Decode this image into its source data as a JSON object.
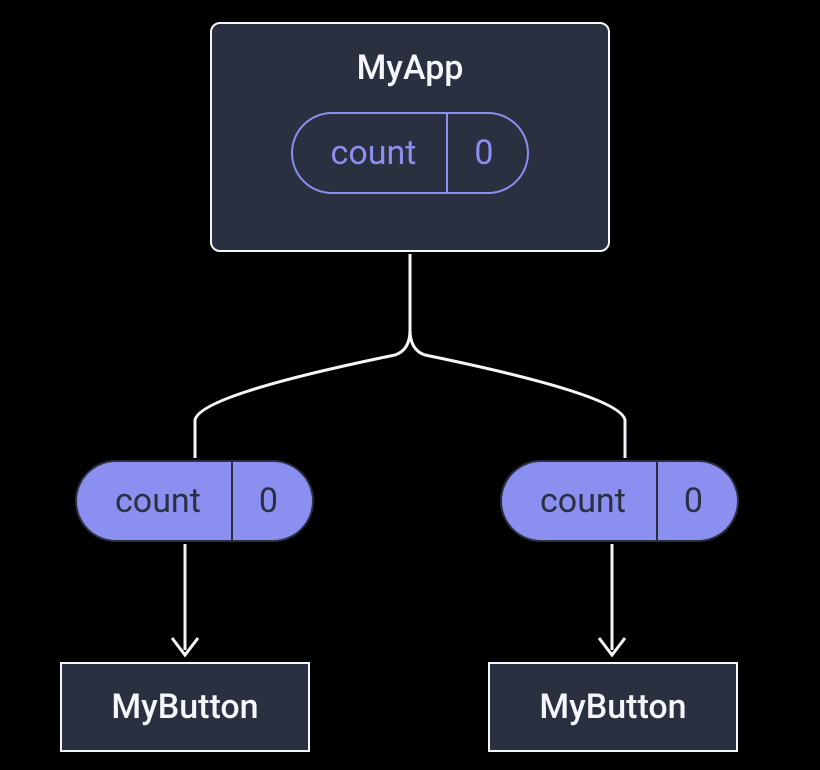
{
  "parent": {
    "title": "MyApp",
    "state": {
      "label": "count",
      "value": "0"
    }
  },
  "props": {
    "left": {
      "label": "count",
      "value": "0"
    },
    "right": {
      "label": "count",
      "value": "0"
    }
  },
  "children": {
    "left": {
      "label": "MyButton"
    },
    "right": {
      "label": "MyButton"
    }
  },
  "colors": {
    "bg": "#000000",
    "box": "#2a3040",
    "outline": "#f5f6fa",
    "accent": "#8b8ff0"
  }
}
